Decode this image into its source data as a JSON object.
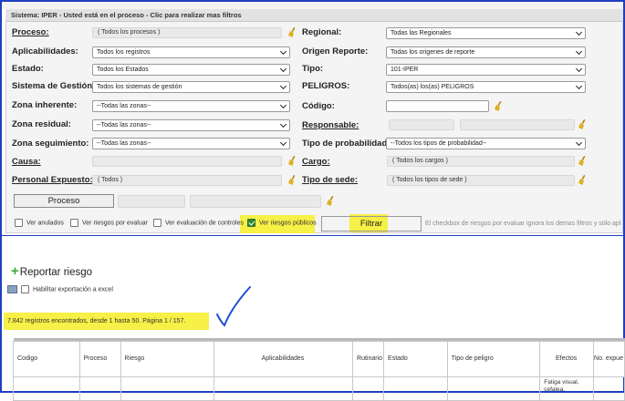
{
  "header": {
    "title": "Sistema: IPER - Usted está en el proceso - Clic para realizar mas filtros"
  },
  "filters": {
    "proceso_label": "Proceso:",
    "proceso_value": "( Todos los procesos )",
    "aplicabilidades_label": "Aplicabilidades:",
    "aplicabilidades_value": "Todos los registros",
    "estado_label": "Estado:",
    "estado_value": "Todos los Estados",
    "sistema_label": "Sistema de Gestión:",
    "sistema_value": "Todos los sistemas de gestión",
    "zona_inherente_label": "Zona inherente:",
    "zona_inherente_value": "--Todas las zonas--",
    "zona_residual_label": "Zona residual:",
    "zona_residual_value": "--Todas las zonas--",
    "zona_seguimiento_label": "Zona seguimiento:",
    "zona_seguimiento_value": "--Todas las zonas--",
    "causa_label": "Causa:",
    "personal_label": "Personal Expuesto:",
    "personal_value": "( Todos )",
    "regional_label": "Regional:",
    "regional_value": "Todas las Regionales",
    "origen_label": "Origen Reporte:",
    "origen_value": "Todas los origenes de reporte",
    "tipo_label": "Tipo:",
    "tipo_value": "101-IPER",
    "peligros_label": "PELIGROS:",
    "peligros_value": "Todos(as) los(as) PELIGROS",
    "codigo_label": "Código:",
    "responsable_label": "Responsable:",
    "tipo_prob_label": "Tipo de probabilidad:",
    "tipo_prob_value": "--Todos los tipos de probabilidad--",
    "cargo_label": "Cargo:",
    "cargo_value": "( Todos los cargos )",
    "tipo_sede_label": "Tipo de sede:",
    "tipo_sede_value": "( Todos los tipos de sede )",
    "proceso_button": "Proceso"
  },
  "checkboxes": {
    "ver_anulados": "Ver anulados",
    "ver_riesgos_evaluar": "Ver riesgos por evaluar",
    "ver_evaluacion_controles": "Ver evaluación de controles",
    "ver_riesgos_publicos": "Ver riesgos públicos",
    "ver_riesgos_publicos_checked": true
  },
  "filtrar_button": "Filtrar",
  "note": "El checkbox de riesgos por evaluar ignora los demas filtros y sólo apl",
  "reportar_riesgo": "Reportar riesgo",
  "export_label": "Habilitar exportación a excel",
  "records_text": "7.842 registros encontrados, desde 1 hasta 50. Página 1 / 157.",
  "table": {
    "headers": [
      "Codigo",
      "Proceso",
      "Riesgo",
      "Aplicabilidades",
      "Rutinario",
      "Estado",
      "Tipo de peligro",
      "Efectos",
      "No. expue"
    ],
    "first_row_efectos": "Fatiga visual, cefalea,"
  },
  "colors": {
    "highlight": "#f7f046",
    "accent_blue": "#1f3fbf",
    "check_green": "#2e8b2e"
  }
}
